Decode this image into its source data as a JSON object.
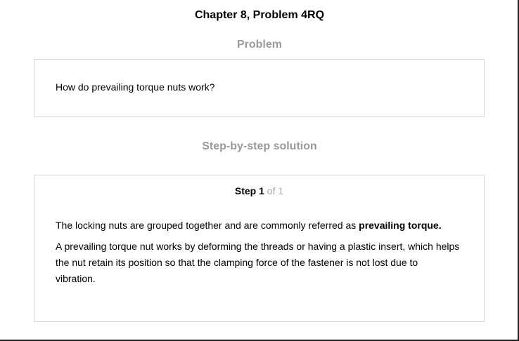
{
  "header": {
    "title": "Chapter 8, Problem 4RQ"
  },
  "problem": {
    "heading": "Problem",
    "text": "How do prevailing torque nuts work?"
  },
  "solution": {
    "heading": "Step-by-step solution",
    "step_label": "Step",
    "step_number": "1",
    "step_total": "of 1",
    "p1_text": "The locking nuts are grouped together and are commonly referred as",
    "p1_emphasis": "prevailing torque.",
    "p2_text": "A prevailing torque nut works by deforming the threads or having a plastic insert, which helps the nut retain its position so that the clamping force of the fastener is not lost due to vibration."
  },
  "colors": {
    "heading_gray": "#9a9a9a",
    "border": "#d6d6d6",
    "muted": "#a8a8a8"
  }
}
